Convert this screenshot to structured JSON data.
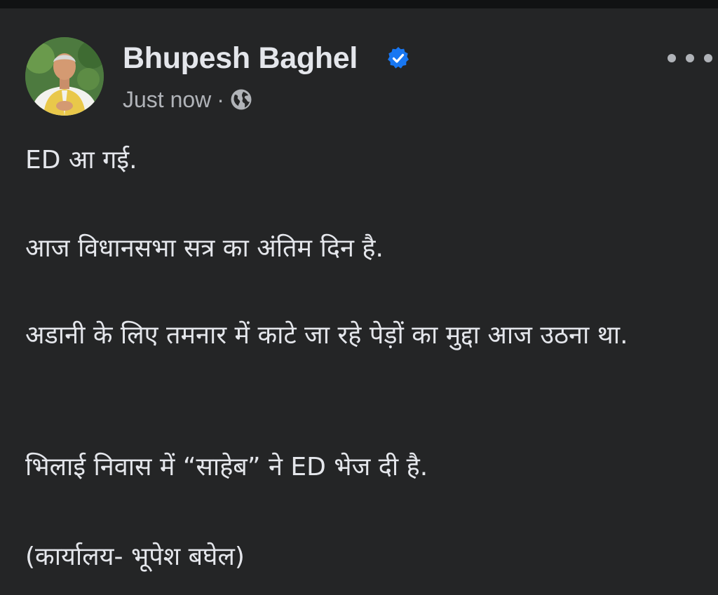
{
  "post": {
    "author": {
      "name": "Bhupesh Baghel",
      "verified": true,
      "avatar_icon": "profile-photo"
    },
    "timestamp": "Just now",
    "separator": "·",
    "audience_icon": "globe-icon",
    "menu_icon": "more-options-icon",
    "body": {
      "p1": "ED आ गई.",
      "p2": "आज विधानसभा सत्र का अंतिम दिन है.",
      "p3": "अडानी के लिए तमनार में काटे जा रहे पेड़ों का मुद्दा आज उठना था.",
      "p4": "भिलाई निवास में “साहेब” ने ED भेज दी है.",
      "p5": "(कार्यालय- भूपेश बघेल)"
    }
  },
  "colors": {
    "background": "#242526",
    "primary_text": "#e4e6eb",
    "secondary_text": "#b0b3b8",
    "verified_badge": "#1877f2"
  }
}
